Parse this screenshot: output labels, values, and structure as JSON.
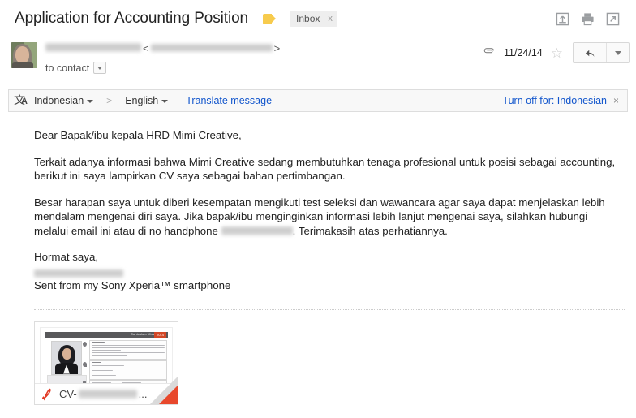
{
  "header": {
    "subject": "Application for Accounting Position",
    "label_icon": "label-tag-icon",
    "inbox_chip": "Inbox",
    "inbox_chip_remove": "x",
    "icons": [
      {
        "name": "archive-icon",
        "title": "Archive"
      },
      {
        "name": "print-icon",
        "title": "Print"
      },
      {
        "name": "open-in-new-window-icon",
        "title": "Open in new window"
      }
    ]
  },
  "sender": {
    "avatar_alt": "sender-avatar",
    "name_redacted": "",
    "email_open_bracket": "<",
    "email_close_bracket": ">",
    "email_redacted": "",
    "to_label": "to contact",
    "attachment_icon": "paperclip-icon",
    "date": "11/24/14",
    "star": "☆",
    "reply_icon": "reply-arrow-icon",
    "reply_more_icon": "chevron-down-icon"
  },
  "translate": {
    "icon": "translate-icon",
    "source_language": "Indonesian",
    "separator": ">",
    "target_language": "English",
    "action_link": "Translate message",
    "turn_off_label": "Turn off for: Indonesian",
    "close": "×"
  },
  "body": {
    "greeting": "Dear Bapak/ibu kepala HRD Mimi Creative,",
    "paragraph_1": "Terkait adanya informasi bahwa Mimi Creative sedang membutuhkan tenaga profesional untuk posisi sebagai accounting, berikut ini saya lampirkan CV saya sebagai bahan pertimbangan.",
    "paragraph_2_part_1": "Besar harapan saya untuk diberi kesempatan mengikuti test seleksi dan wawancara agar saya dapat menjelaskan lebih mendalam mengenai diri saya. Jika bapak/ibu menginginkan informasi lebih lanjut mengenai saya, silahkan hubungi melalui email ini atau di no handphone",
    "paragraph_2_part_2": ". Terimakasih atas perhatiannya.",
    "closing": "Hormat saya,",
    "signature_redacted": "",
    "sent_from": "Sent from my Sony Xperia™ smartphone"
  },
  "attachment": {
    "file_name_prefix": "CV-",
    "file_name_ellipsis": "...",
    "file_type_icon": "pdf-icon",
    "thumbnail_title": "Curriculum Vitae",
    "thumbnail_year": "2014",
    "download_corner": "download-corner-icon"
  },
  "colors": {
    "link": "#1155cc",
    "label_tag": "#f7cb4d",
    "pdf_red": "#e8482c",
    "chip_bg": "#eeeeee"
  }
}
